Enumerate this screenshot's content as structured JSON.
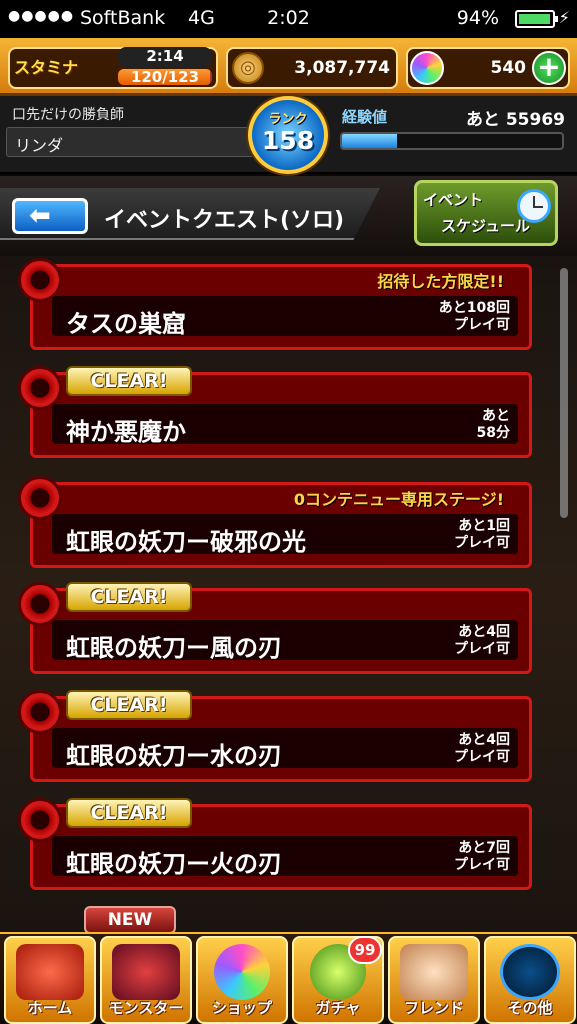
{
  "status_bar": {
    "signal": "●●●●●",
    "carrier": "SoftBank",
    "network": "4G",
    "time": "2:02",
    "battery_percent": "94%",
    "battery_level": 0.94
  },
  "hud": {
    "stamina_label": "スタミナ",
    "stamina_timer": "2:14",
    "stamina_value": "120/123",
    "stamina_fill": 0.9756,
    "coins": "3,087,774",
    "orbs": "540",
    "plus_label": "+"
  },
  "player": {
    "title": "口先だけの勝負師",
    "name": "リンダ",
    "rank_label": "ランク",
    "rank": "158",
    "exp_label": "経験値",
    "exp_remaining": "あと 55969",
    "exp_fill": 0.25
  },
  "header": {
    "back_arrow": "⬅",
    "title": "イベントクエスト(ソロ)",
    "schedule_line1": "イベント",
    "schedule_line2": "スケジュール"
  },
  "quests": [
    {
      "name": "タスの巣窟",
      "remain_line1": "あと108回",
      "remain_line2": "プレイ可",
      "note": "招待した方限定!!",
      "badge": ""
    },
    {
      "name": "神か悪魔か",
      "remain_line1": "あと",
      "remain_line2": "58分",
      "note": "",
      "badge": "CLEAR!"
    },
    {
      "name": "虹眼の妖刀ー破邪の光",
      "remain_line1": "あと1回",
      "remain_line2": "プレイ可",
      "note": "0コンテニュー専用ステージ!",
      "badge": ""
    },
    {
      "name": "虹眼の妖刀ー風の刃",
      "remain_line1": "あと4回",
      "remain_line2": "プレイ可",
      "note": "",
      "badge": "CLEAR!"
    },
    {
      "name": "虹眼の妖刀ー水の刃",
      "remain_line1": "あと4回",
      "remain_line2": "プレイ可",
      "note": "",
      "badge": "CLEAR!"
    },
    {
      "name": "虹眼の妖刀ー火の刃",
      "remain_line1": "あと7回",
      "remain_line2": "プレイ可",
      "note": "",
      "badge": "CLEAR!"
    }
  ],
  "next_badge": "NEW",
  "nav": {
    "home": "ホーム",
    "monster": "モンスター",
    "shop": "ショップ",
    "gacha": "ガチャ",
    "gacha_count": "99",
    "friend": "フレンド",
    "other": "その他"
  },
  "colors": {
    "hud_orange": "#f5b436",
    "quest_red": "#d41818",
    "clear_gold": "#d7a400",
    "exp_blue": "#1b83de"
  }
}
